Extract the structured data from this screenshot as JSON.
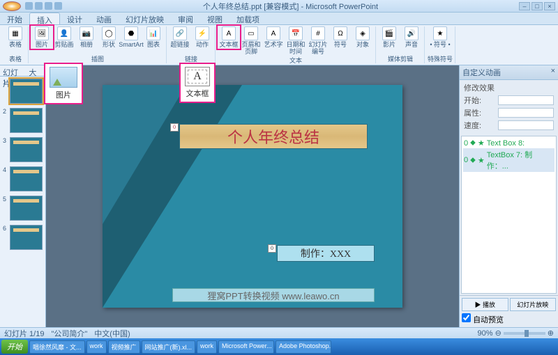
{
  "title": "个人年终总结.ppt [兼容模式] - Microsoft PowerPoint",
  "tabs": [
    "开始",
    "插入",
    "设计",
    "动画",
    "幻灯片放映",
    "审阅",
    "视图",
    "加载项"
  ],
  "activeTab": 1,
  "ribbon": {
    "groups": [
      {
        "label": "表格",
        "items": [
          {
            "l": "表格",
            "i": "▦"
          }
        ]
      },
      {
        "label": "插图",
        "items": [
          {
            "l": "图片",
            "i": "🖼",
            "hl": true
          },
          {
            "l": "剪贴画",
            "i": "👤"
          },
          {
            "l": "相册",
            "i": "📷"
          },
          {
            "l": "形状",
            "i": "◯"
          },
          {
            "l": "SmartArt",
            "i": "⬣"
          },
          {
            "l": "图表",
            "i": "📊"
          }
        ]
      },
      {
        "label": "链接",
        "items": [
          {
            "l": "超链接",
            "i": "🔗"
          },
          {
            "l": "动作",
            "i": "⚡"
          }
        ]
      },
      {
        "label": "文本",
        "items": [
          {
            "l": "文本框",
            "i": "A",
            "hl": true
          },
          {
            "l": "页眉和页脚",
            "i": "▭"
          },
          {
            "l": "艺术字",
            "i": "A"
          },
          {
            "l": "日期和时间",
            "i": "📅"
          },
          {
            "l": "幻灯片编号",
            "i": "#"
          },
          {
            "l": "符号",
            "i": "Ω"
          },
          {
            "l": "对象",
            "i": "◈"
          }
        ]
      },
      {
        "label": "媒体剪辑",
        "items": [
          {
            "l": "影片",
            "i": "🎬"
          },
          {
            "l": "声音",
            "i": "🔊"
          }
        ]
      },
      {
        "label": "特殊符号",
        "items": [
          {
            "l": "• 符号 •",
            "i": "★"
          }
        ]
      }
    ]
  },
  "callouts": {
    "pic": "图片",
    "txt": "文本框"
  },
  "slidePane": {
    "tabs": [
      "幻灯片",
      "大纲"
    ],
    "count": 6
  },
  "slide": {
    "title": "个人年终总结",
    "author": "制作：XXX",
    "watermark": "狸窝PPT转换视频  www.leawo.cn"
  },
  "animPane": {
    "title": "自定义动画",
    "modifyLabel": "修改效果",
    "rows": [
      {
        "k": "开始"
      },
      {
        "k": "属性"
      },
      {
        "k": "速度"
      }
    ],
    "items": [
      "Text Box 8:",
      "TextBox 7: 制作：..."
    ],
    "play": "▶ 播放",
    "slideshow": "幻灯片放映",
    "autoPreview": "自动预览"
  },
  "status": {
    "slide": "幻灯片 1/19",
    "theme": "\"公司简介\"",
    "lang": "中文(中国)",
    "zoom": "90%"
  },
  "taskbar": {
    "start": "开始",
    "items": [
      "唱徐然风靡 - 文...",
      "work",
      "视频推广",
      "网站推广(新).xl...",
      "work",
      "Microsoft Power...",
      "Adobe Photoshop..."
    ],
    "time": ""
  }
}
